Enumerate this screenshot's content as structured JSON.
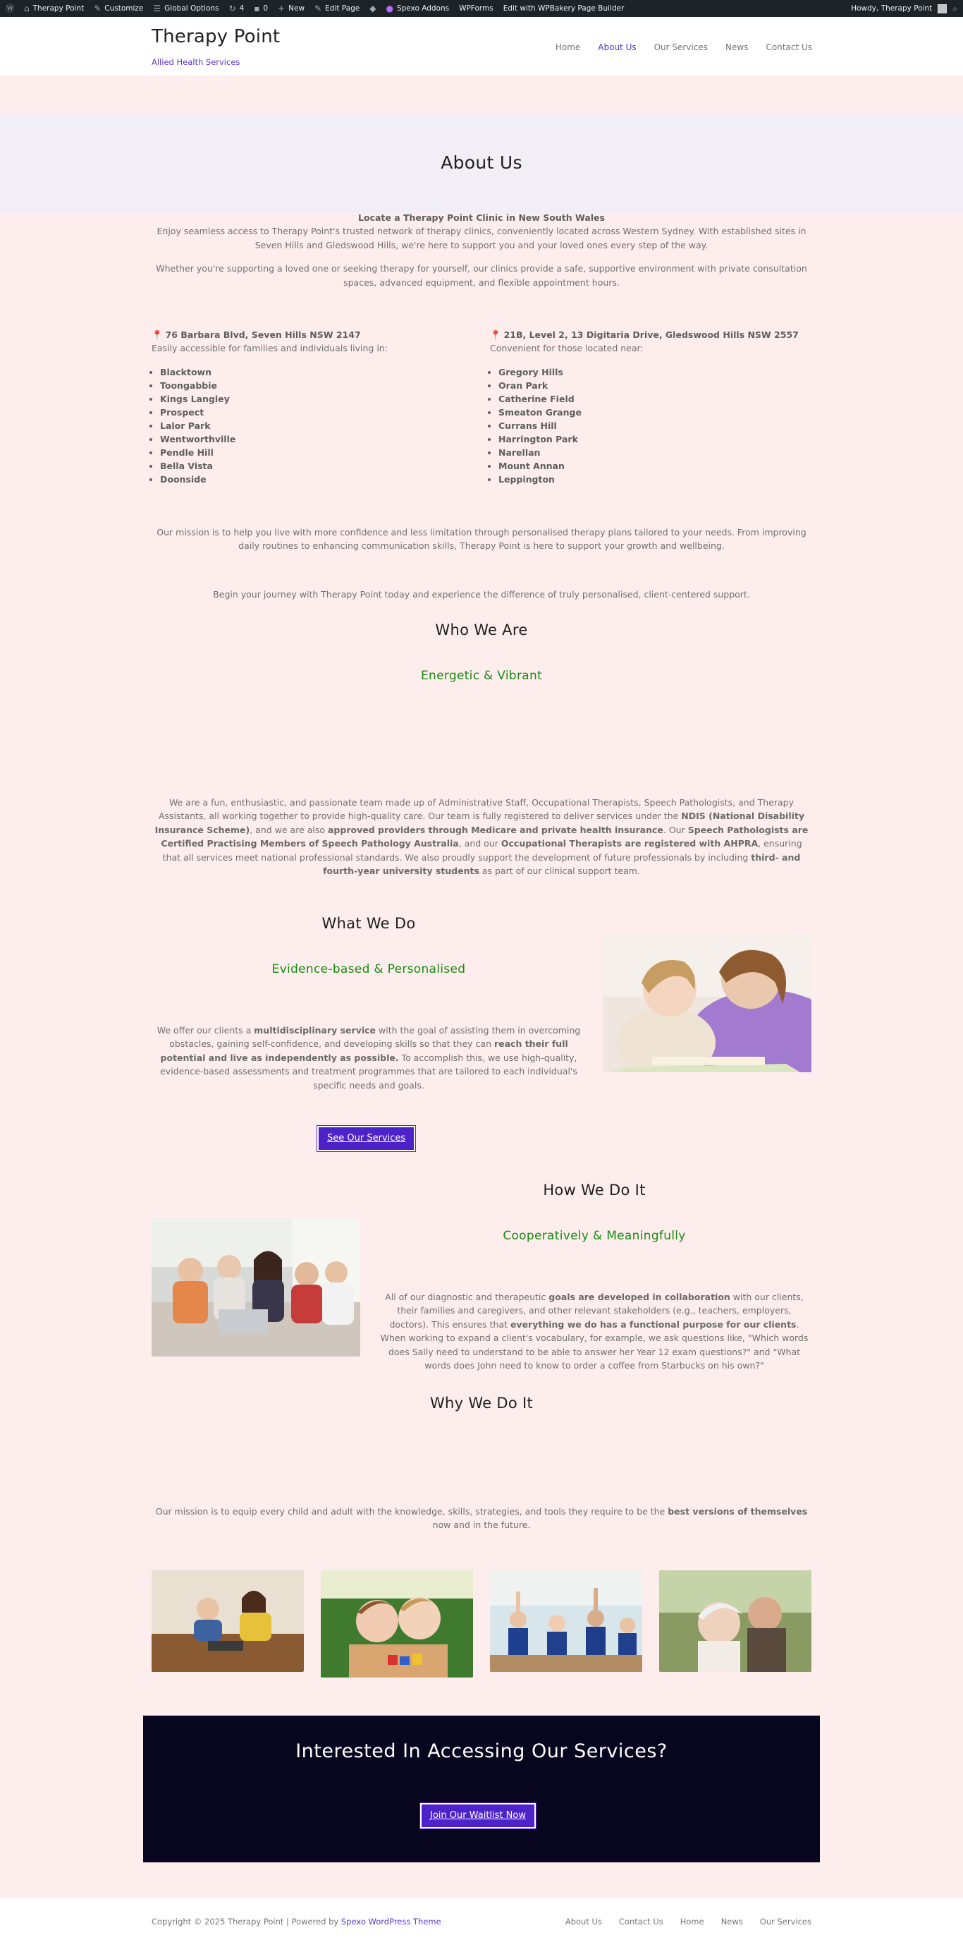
{
  "admin_bar": {
    "site_name": "Therapy Point",
    "customize": "Customize",
    "global_options": "Global Options",
    "updates_count": "4",
    "comments_count": "0",
    "new": "New",
    "edit_page": "Edit Page",
    "spexo_addons": "Spexo Addons",
    "wpforms": "WPForms",
    "wpbakery": "Edit with WPBakery Page Builder",
    "howdy": "Howdy, Therapy Point"
  },
  "header": {
    "site_title": "Therapy Point",
    "tagline": "Allied Health Services",
    "nav": [
      "Home",
      "About Us",
      "Our Services",
      "News",
      "Contact Us"
    ],
    "active_nav": "About Us"
  },
  "page_title": "About Us",
  "intro": {
    "heading": "Locate a Therapy Point Clinic in New South Wales",
    "p1": "Enjoy seamless access to Therapy Point's trusted network of therapy clinics, conveniently located across Western Sydney. With established sites in Seven Hills and Gledswood Hills, we're here to support you and your loved ones every step of the way.",
    "p2": "Whether you're supporting a loved one or seeking therapy for yourself, our clinics provide a safe, supportive environment with private consultation spaces, advanced equipment, and flexible appointment hours."
  },
  "locations": [
    {
      "pin": "📍",
      "address": "76 Barbara Blvd, Seven Hills NSW 2147",
      "note": "Easily accessible for families and individuals living in:",
      "suburbs": [
        "Blacktown",
        "Toongabbie",
        "Kings Langley",
        "Prospect",
        "Lalor Park",
        "Wentworthville",
        "Pendle Hill",
        "Bella Vista",
        "Doonside"
      ]
    },
    {
      "pin": "📍",
      "address": "21B, Level 2, 13 Digitaria Drive, Gledswood Hills NSW 2557",
      "note": "Convenient for those located near:",
      "suburbs": [
        "Gregory Hills",
        "Oran Park",
        "Catherine Field",
        "Smeaton Grange",
        "Currans Hill",
        "Harrington Park",
        "Narellan",
        "Mount Annan",
        "Leppington"
      ]
    }
  ],
  "mission": "Our mission is to help you live with more confidence and less limitation through personalised therapy plans tailored to your needs. From improving daily routines to enhancing communication skills, Therapy Point is here to support your growth and wellbeing.",
  "journey": "Begin your journey with Therapy Point today and experience the difference of truly personalised, client-centered support.",
  "who": {
    "title": "Who We Are",
    "subtitle": "Energetic & Vibrant",
    "t1": "We are a fun, enthusiastic, and passionate team made up of Administrative Staff, Occupational Therapists, Speech Pathologists, and Therapy Assistants, all working together to provide high-quality care. Our team is fully registered to deliver services under the ",
    "b1": "NDIS (National Disability Insurance Scheme)",
    "t2": ", and we are also ",
    "b2": "approved providers through Medicare and private health insurance",
    "t3": ". Our ",
    "b3": "Speech Pathologists are Certified Practising Members of Speech Pathology Australia",
    "t4": ", and our ",
    "b4": "Occupational Therapists are registered with AHPRA",
    "t5": ", ensuring that all services meet national professional standards. We also proudly support the development of future professionals by including ",
    "b5": "third- and fourth-year university students",
    "t6": " as part of our clinical support team."
  },
  "what": {
    "title": "What We Do",
    "subtitle": "Evidence-based & Personalised",
    "t1": "We offer our clients a ",
    "b1": "multidisciplinary service",
    "t2": " with the goal of assisting them in overcoming obstacles, gaining self-confidence, and developing skills so that they can ",
    "b2": "reach their full potential and live as independently as possible.",
    "t3": " To accomplish this, we use high-quality, evidence-based assessments and treatment programmes that are tailored to each individual's specific needs and goals.",
    "button": "See Our Services"
  },
  "how": {
    "title": "How We Do It",
    "subtitle": "Cooperatively & Meaningfully",
    "t1": "All of our diagnostic and therapeutic ",
    "b1": "goals are developed in collaboration",
    "t2": " with our clients, their families and caregivers, and other relevant stakeholders (e.g., teachers, employers, doctors). This ensures that ",
    "b2": "everything we do has a functional purpose for our clients",
    "t3": ". When working to expand a client's vocabulary, for example, we ask questions like, \"Which words does Sally need to understand to be able to answer her Year 12 exam questions?\" and \"What words does John need to know to order a coffee from Starbucks on his own?\""
  },
  "why": {
    "title": "Why We Do It",
    "t1": "Our mission is to equip every child and adult with the knowledge, skills, strategies, and tools they require to be the ",
    "b1": "best versions of themselves",
    "t2": " now and in the future."
  },
  "cta": {
    "title": "Interested In Accessing Our Services?",
    "button": "Join Our Waitlist Now"
  },
  "footer": {
    "copyright": "Copyright © 2025 Therapy Point | Powered by ",
    "theme": "Spexo WordPress Theme",
    "nav": [
      "About Us",
      "Contact Us",
      "Home",
      "News",
      "Our Services"
    ]
  },
  "colors": {
    "accent": "#5b38d3",
    "button": "#4e22c9",
    "green": "#198a11",
    "page_bg": "#fdeeed",
    "cta_bg": "#08051f"
  }
}
